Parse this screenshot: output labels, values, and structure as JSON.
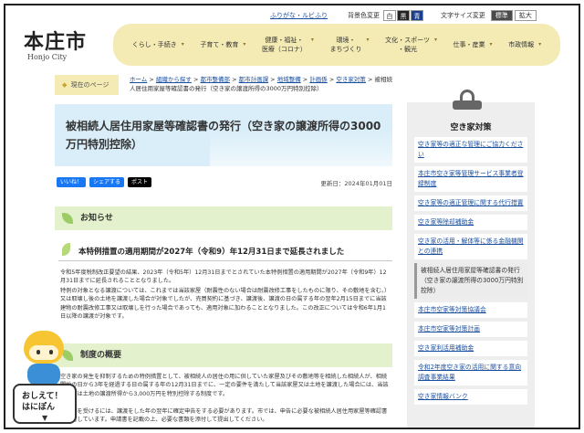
{
  "header": {
    "logo_main": "本庄市",
    "logo_sub": "Honjo City",
    "furigana": "ふりがな・ルビふり",
    "bg_label": "背景色変更",
    "bg_buttons": [
      "白",
      "黒",
      "青"
    ],
    "size_label": "文字サイズ変更",
    "size_buttons": [
      "標準",
      "拡大"
    ]
  },
  "nav": [
    "くらし・手続き",
    "子育て・教育",
    "健康・福祉・\n医療（コロナ）",
    "環境・\nまちづくり",
    "文化・スポーツ\n・観光",
    "仕事・産業",
    "市政情報"
  ],
  "breadcrumb": {
    "label": "現在のページ",
    "links": [
      "ホーム",
      "組織から探す",
      "都市整備部",
      "都市計画課",
      "地域整備",
      "計画係",
      "空き家対策"
    ],
    "current": "被相続人居住用家屋等確認書の発行（空き家の譲渡所得の3000万円特別控除）"
  },
  "page": {
    "title": "被相続人居住用家屋等確認書の発行（空き家の譲渡所得の3000万円特別控除）",
    "social": [
      "いいね！",
      "シェアする",
      "ポスト"
    ],
    "updated": "更新日：2024年01月01日"
  },
  "sections": {
    "notice_heading": "お知らせ",
    "notice_sub": "本特例措置の適用期間が2027年（令和9）年12月31日まで延長されました",
    "notice_p1": "令和5年度税制改正要望の結果、2023年（令和5年）12月31日までとされていた本特例措置の適用期間が2027年（令和9年）12月31日までに延長されることとなりました。",
    "notice_p2": "特例の対象となる譲渡については、これまでは当該家屋（耐震性のない場合は耐震改修工事をしたものに限り、その敷地を含む。）又は取壊し後の土地を譲渡した場合が対象でしたが、売買契約に基づき、譲渡後、譲渡の日の属する年の翌年2月15日までに当該建物の耐震改修工事又は取壊しを行った場合であっても、適用対象に加わることとなりました。この改正については令和6年1月1日以降の譲渡が対象です。",
    "overview_heading": "制度の概要",
    "overview_p1": "空き家の発生を抑制するための特例措置として、被相続人の居住の用に供していた家屋及びその敷地等を相続した相続人が、相続開始の日から3年を経過する日の属する年の12月31日までに、一定の要件を満たして当該家屋又は土地を譲渡した場合には、当該家屋又は土地の譲渡所得から3,000万円を特別控除する制度です。",
    "overview_p2": "本特例を受けるには、譲渡をした年の翌年に確定申告をする必要があります。市では、申告に必要な被相続人居住用家屋等確認書を発行しています。申請書を記載の上、必要な書類を添付して提出してください。"
  },
  "sidebar": {
    "title": "空き家対策",
    "items": [
      "空き家等の適正な管理にご協力ください",
      "本庄市空き家等管理サービス事業者登録制度",
      "空き家等の適正管理に関する代行措置",
      "空き家等除却補助金",
      "空き家の活用・解体等に係る金融機関との連携",
      "被相続人居住用家屋等確認書の発行（空き家の譲渡所得の3000万円特別控除）",
      "本庄市空家等対策協議会",
      "本庄市空家等対策計画",
      "空き家利活用補助金",
      "令和2年度空き家の活用に関する意向調査事業結果",
      "空き家情報バンク"
    ],
    "current_index": 5
  },
  "mascot": {
    "bubble_line1": "おしえて！",
    "bubble_line2": "はにぽん",
    "bubble_arrow": "▼"
  }
}
